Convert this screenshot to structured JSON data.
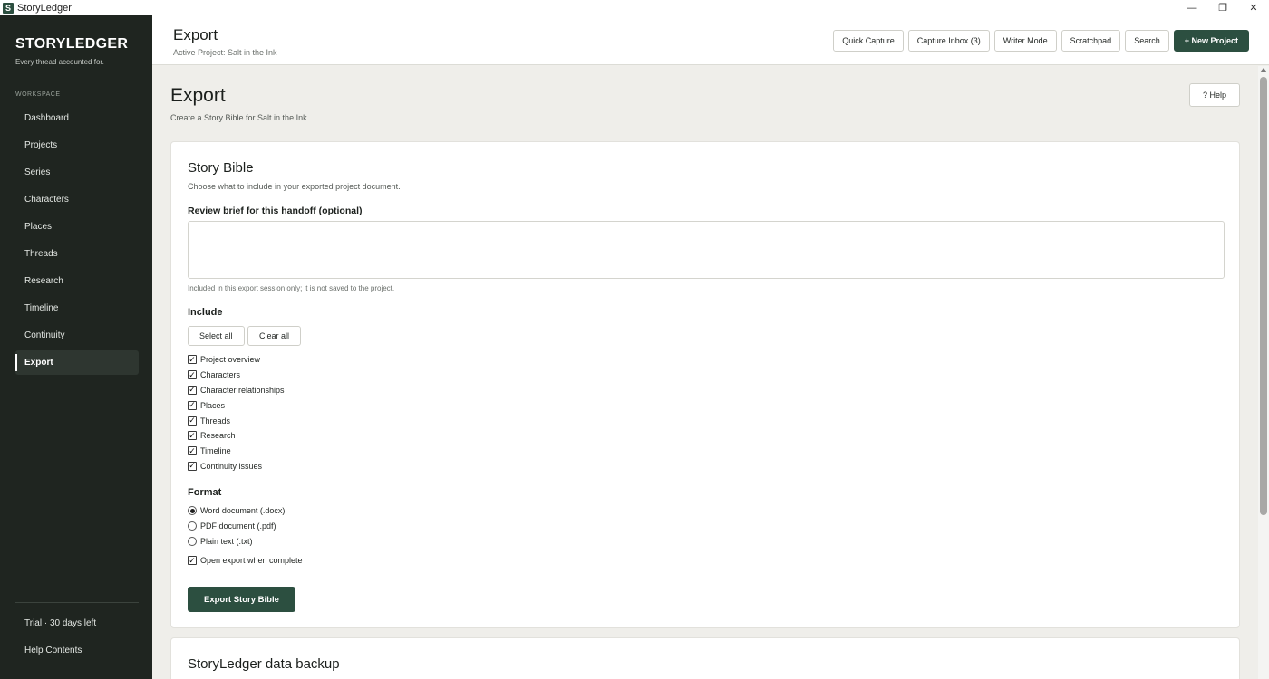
{
  "window": {
    "app_icon_letter": "S",
    "title": "StoryLedger",
    "controls": {
      "minimize": "—",
      "restore": "❐",
      "close": "✕"
    }
  },
  "sidebar": {
    "brand": "STORYLEDGER",
    "tagline": "Every thread accounted for.",
    "section_label": "WORKSPACE",
    "items": [
      {
        "label": "Dashboard"
      },
      {
        "label": "Projects"
      },
      {
        "label": "Series"
      },
      {
        "label": "Characters"
      },
      {
        "label": "Places"
      },
      {
        "label": "Threads"
      },
      {
        "label": "Research"
      },
      {
        "label": "Timeline"
      },
      {
        "label": "Continuity"
      },
      {
        "label": "Export",
        "active": true
      }
    ],
    "trial": "Trial · 30 days left",
    "help": "Help Contents"
  },
  "header": {
    "title": "Export",
    "subtitle": "Active Project: Salt in the Ink",
    "quick_capture": "Quick Capture",
    "capture_inbox": "Capture Inbox (3)",
    "writer_mode": "Writer Mode",
    "scratchpad": "Scratchpad",
    "search": "Search",
    "new_project": "+ New Project"
  },
  "page": {
    "title": "Export",
    "subtitle": "Create a Story Bible for Salt in the Ink.",
    "help": "? Help"
  },
  "story_bible": {
    "title": "Story Bible",
    "description": "Choose what to include in your exported project document.",
    "brief_label": "Review brief for this handoff (optional)",
    "brief_value": "",
    "brief_hint": "Included in this export session only; it is not saved to the project.",
    "include_label": "Include",
    "select_all": "Select all",
    "clear_all": "Clear all",
    "include_items": [
      {
        "label": "Project overview",
        "checked": true
      },
      {
        "label": "Characters",
        "checked": true
      },
      {
        "label": "Character relationships",
        "checked": true
      },
      {
        "label": "Places",
        "checked": true
      },
      {
        "label": "Threads",
        "checked": true
      },
      {
        "label": "Research",
        "checked": true
      },
      {
        "label": "Timeline",
        "checked": true
      },
      {
        "label": "Continuity issues",
        "checked": true
      }
    ],
    "format_label": "Format",
    "formats": [
      {
        "label": "Word document (.docx)",
        "selected": true
      },
      {
        "label": "PDF document (.pdf)",
        "selected": false
      },
      {
        "label": "Plain text (.txt)",
        "selected": false
      }
    ],
    "open_when_complete": {
      "label": "Open export when complete",
      "checked": true
    },
    "export_button": "Export Story Bible"
  },
  "backup": {
    "title": "StoryLedger data backup"
  },
  "colors": {
    "sidebar_bg": "#1f2520",
    "accent": "#2c4f40",
    "page_bg": "#efeeea"
  }
}
